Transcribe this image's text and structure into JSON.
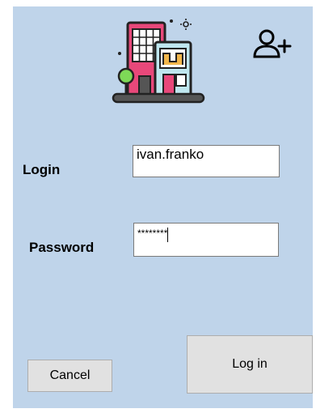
{
  "form": {
    "background": "#bfd4ea",
    "logo_icon": "city-buildings-icon",
    "add_user_icon": "add-user-icon"
  },
  "login": {
    "label": "Login",
    "value": "ivan.franko"
  },
  "password": {
    "label": "Password",
    "masked_value": "********"
  },
  "buttons": {
    "cancel_label": "Cancel",
    "login_label": "Log in"
  }
}
